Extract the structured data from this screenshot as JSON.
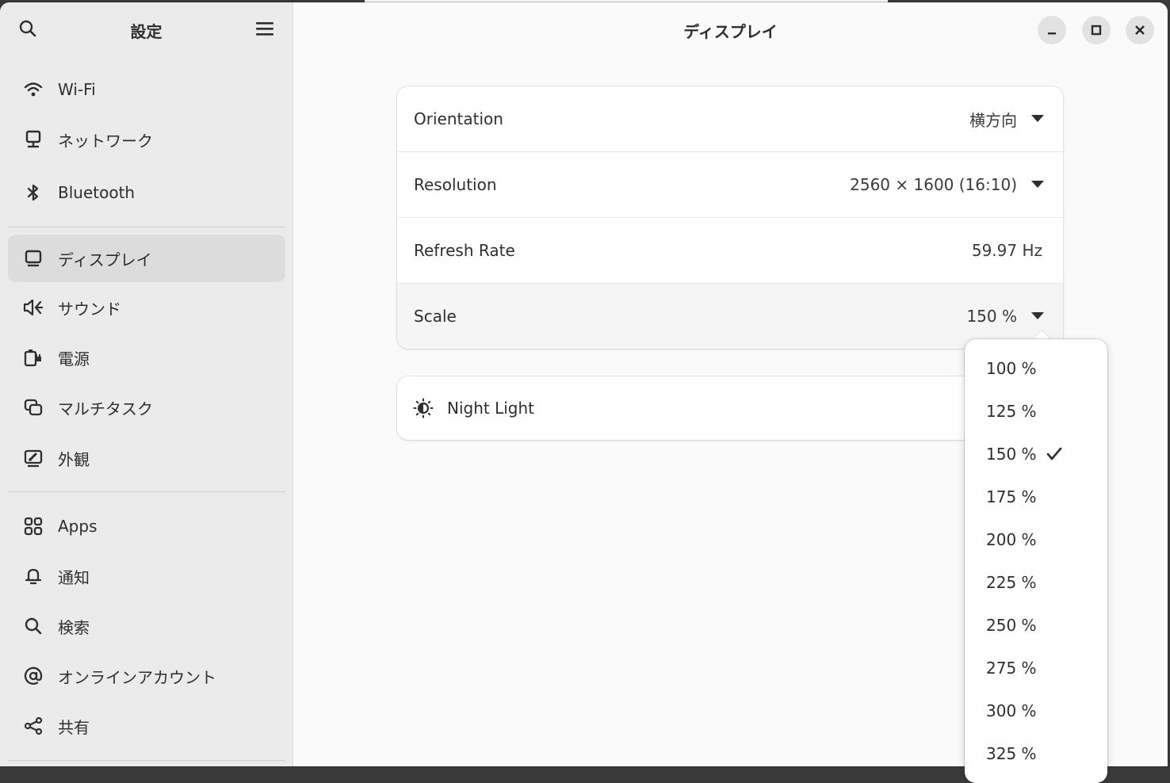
{
  "sidebar": {
    "title": "設定",
    "groups": [
      [
        {
          "label": "Wi-Fi",
          "icon": "wifi-icon"
        },
        {
          "label": "ネットワーク",
          "icon": "network-icon"
        },
        {
          "label": "Bluetooth",
          "icon": "bluetooth-icon"
        }
      ],
      [
        {
          "label": "ディスプレイ",
          "icon": "display-icon",
          "active": true
        },
        {
          "label": "サウンド",
          "icon": "speaker-icon"
        },
        {
          "label": "電源",
          "icon": "power-icon"
        },
        {
          "label": "マルチタスク",
          "icon": "multitasking-icon"
        },
        {
          "label": "外観",
          "icon": "appearance-icon"
        }
      ],
      [
        {
          "label": "Apps",
          "icon": "apps-grid-icon"
        },
        {
          "label": "通知",
          "icon": "bell-icon"
        },
        {
          "label": "検索",
          "icon": "search-icon"
        },
        {
          "label": "オンラインアカウント",
          "icon": "at-sign-icon"
        },
        {
          "label": "共有",
          "icon": "share-icon"
        }
      ]
    ]
  },
  "header": {
    "title": "ディスプレイ"
  },
  "display_settings": {
    "orientation": {
      "label": "Orientation",
      "value": "横方向"
    },
    "resolution": {
      "label": "Resolution",
      "value": "2560 × 1600 (16:10)"
    },
    "refresh_rate": {
      "label": "Refresh Rate",
      "value": "59.97 Hz"
    },
    "scale": {
      "label": "Scale",
      "value": "150 %"
    }
  },
  "night_light": {
    "label": "Night Light",
    "icon": "night-light-icon"
  },
  "scale_menu": {
    "options": [
      "100 %",
      "125 %",
      "150 %",
      "175 %",
      "200 %",
      "225 %",
      "250 %",
      "275 %",
      "300 %",
      "325 %"
    ],
    "selected": "150 %"
  },
  "colors": {
    "sidebar_bg": "#ebebeb",
    "content_bg": "#fafafa",
    "active_item": "#dcdcdc",
    "text": "#2e2e2e"
  }
}
